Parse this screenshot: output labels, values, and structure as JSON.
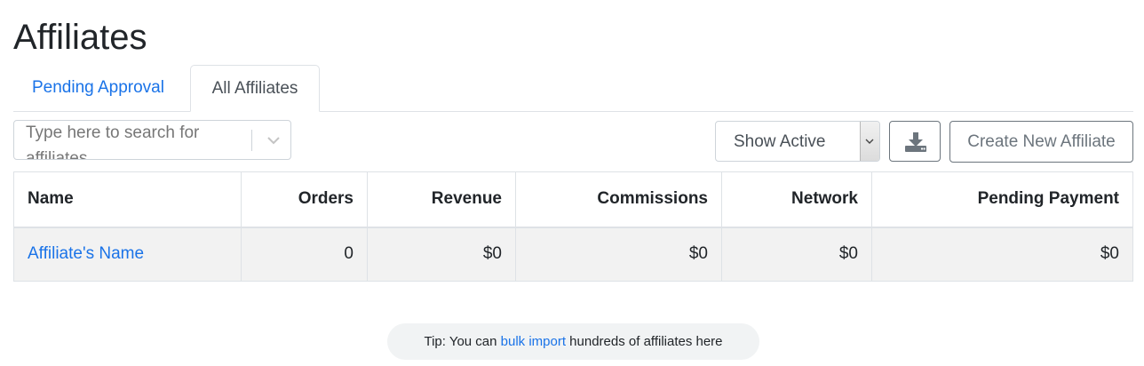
{
  "page": {
    "title": "Affiliates"
  },
  "tabs": [
    {
      "label": "Pending Approval",
      "active": false
    },
    {
      "label": "All Affiliates",
      "active": true
    }
  ],
  "toolbar": {
    "search_placeholder": "Type here to search for affiliates",
    "status_select_value": "Show Active",
    "download_icon": "download-icon",
    "create_label": "Create New Affiliate"
  },
  "table": {
    "headers": {
      "name": "Name",
      "orders": "Orders",
      "revenue": "Revenue",
      "commissions": "Commissions",
      "network": "Network",
      "pending_payment": "Pending Payment"
    },
    "rows": [
      {
        "name": "Affiliate's Name",
        "orders": "0",
        "revenue": "$0",
        "commissions": "$0",
        "network": "$0",
        "pending_payment": "$0"
      }
    ]
  },
  "tip": {
    "prefix": "Tip: You can ",
    "link": "bulk import",
    "suffix": " hundreds of affiliates here"
  },
  "colors": {
    "link": "#1a73e8",
    "row_bg": "#f2f2f2",
    "tip_bg": "#f1f3f4"
  }
}
